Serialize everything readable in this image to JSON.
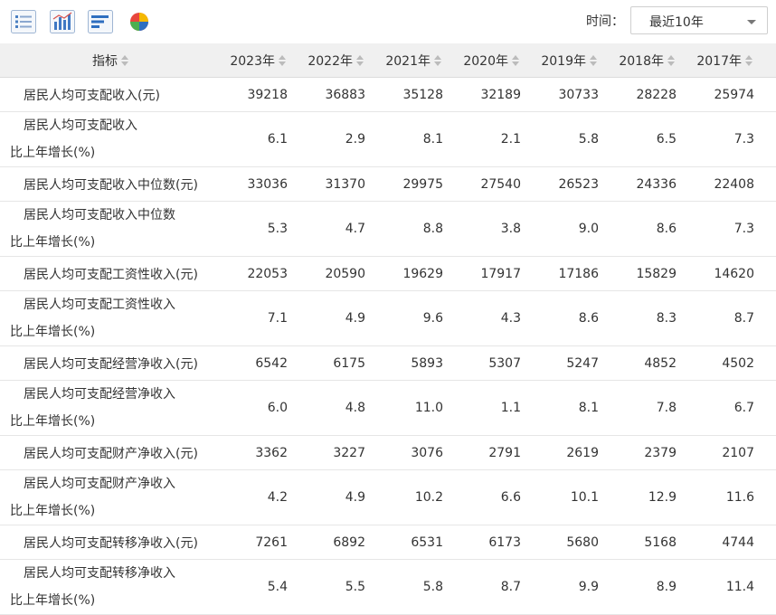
{
  "toolbar": {
    "icons": [
      "table-view-icon",
      "bar-chart-icon",
      "horizontal-bar-chart-icon",
      "pie-chart-icon"
    ],
    "time_label": "时间：",
    "time_value": "最近10年"
  },
  "table": {
    "header": {
      "indicator": "指标",
      "years": [
        "2023年",
        "2022年",
        "2021年",
        "2020年",
        "2019年",
        "2018年",
        "2017年"
      ]
    },
    "rows": [
      {
        "name": "居民人均可支配收入(元)",
        "values": [
          "39218",
          "36883",
          "35128",
          "32189",
          "30733",
          "28228",
          "25974"
        ]
      },
      {
        "name": "居民人均可支配收入",
        "name2": "比上年增长(%)",
        "values": [
          "6.1",
          "2.9",
          "8.1",
          "2.1",
          "5.8",
          "6.5",
          "7.3"
        ]
      },
      {
        "name": "居民人均可支配收入中位数(元)",
        "values": [
          "33036",
          "31370",
          "29975",
          "27540",
          "26523",
          "24336",
          "22408"
        ]
      },
      {
        "name": "居民人均可支配收入中位数",
        "name2": "比上年增长(%)",
        "values": [
          "5.3",
          "4.7",
          "8.8",
          "3.8",
          "9.0",
          "8.6",
          "7.3"
        ]
      },
      {
        "name": "居民人均可支配工资性收入(元)",
        "values": [
          "22053",
          "20590",
          "19629",
          "17917",
          "17186",
          "15829",
          "14620"
        ]
      },
      {
        "name": "居民人均可支配工资性收入",
        "name2": "比上年增长(%)",
        "values": [
          "7.1",
          "4.9",
          "9.6",
          "4.3",
          "8.6",
          "8.3",
          "8.7"
        ]
      },
      {
        "name": "居民人均可支配经营净收入(元)",
        "values": [
          "6542",
          "6175",
          "5893",
          "5307",
          "5247",
          "4852",
          "4502"
        ]
      },
      {
        "name": "居民人均可支配经营净收入",
        "name2": "比上年增长(%)",
        "values": [
          "6.0",
          "4.8",
          "11.0",
          "1.1",
          "8.1",
          "7.8",
          "6.7"
        ]
      },
      {
        "name": "居民人均可支配财产净收入(元)",
        "values": [
          "3362",
          "3227",
          "3076",
          "2791",
          "2619",
          "2379",
          "2107"
        ]
      },
      {
        "name": "居民人均可支配财产净收入",
        "name2": "比上年增长(%)",
        "values": [
          "4.2",
          "4.9",
          "10.2",
          "6.6",
          "10.1",
          "12.9",
          "11.6"
        ]
      },
      {
        "name": "居民人均可支配转移净收入(元)",
        "values": [
          "7261",
          "6892",
          "6531",
          "6173",
          "5680",
          "5168",
          "4744"
        ]
      },
      {
        "name": "居民人均可支配转移净收入",
        "name2": "比上年增长(%)",
        "values": [
          "5.4",
          "5.5",
          "5.8",
          "8.7",
          "9.9",
          "8.9",
          "11.4"
        ]
      }
    ]
  }
}
